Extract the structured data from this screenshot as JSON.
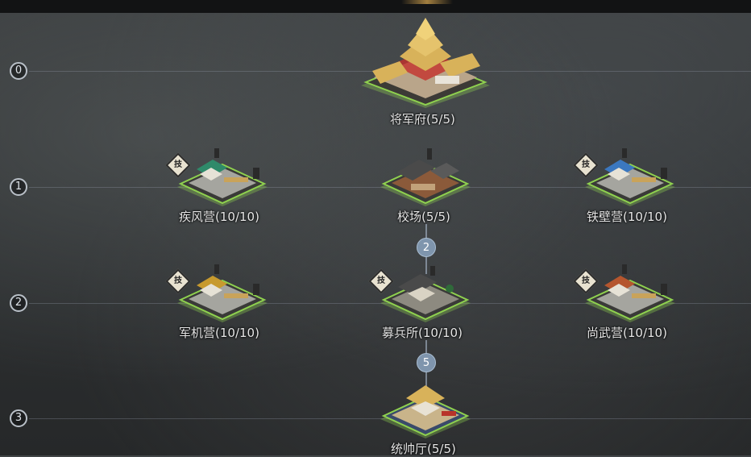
{
  "rows": [
    {
      "level": "0"
    },
    {
      "level": "1"
    },
    {
      "level": "2"
    },
    {
      "level": "3"
    }
  ],
  "buildings": {
    "general_mansion": {
      "label": "将军府(5/5)",
      "icon": "palace-icon"
    },
    "jifeng_camp": {
      "label": "疾风营(10/10)",
      "icon": "walled-camp-green-icon",
      "badge": "技"
    },
    "drill_ground": {
      "label": "校场(5/5)",
      "icon": "drill-ground-icon"
    },
    "tiebi_camp": {
      "label": "铁壁营(10/10)",
      "icon": "walled-camp-blue-icon",
      "badge": "技"
    },
    "junji_camp": {
      "label": "军机营(10/10)",
      "icon": "walled-camp-yellow-icon",
      "badge": "技"
    },
    "recruit_office": {
      "label": "募兵所(10/10)",
      "icon": "recruit-office-icon",
      "badge": "技"
    },
    "shangwu_camp": {
      "label": "尚武营(10/10)",
      "icon": "walled-camp-red-icon",
      "badge": "技"
    },
    "commander_hall": {
      "label": "统帅厅(5/5)",
      "icon": "commander-hall-icon"
    }
  },
  "requirements": [
    {
      "value": "2"
    },
    {
      "value": "5"
    }
  ],
  "colors": {
    "glow": "#8fd14f",
    "roof_green": "#2f8a6a",
    "roof_blue": "#3b78c0",
    "roof_yellow": "#c79a2e",
    "roof_red": "#b5562e",
    "palace_gold": "#d8b25a"
  }
}
